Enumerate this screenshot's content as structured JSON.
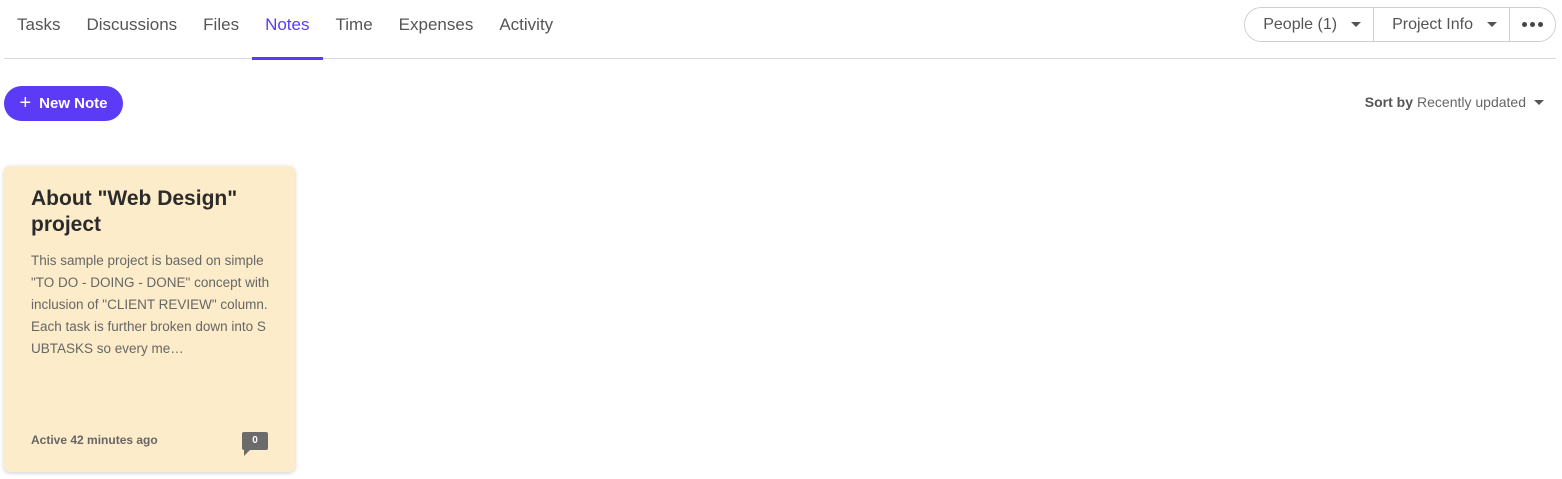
{
  "tabs": [
    {
      "label": "Tasks",
      "active": false
    },
    {
      "label": "Discussions",
      "active": false
    },
    {
      "label": "Files",
      "active": false
    },
    {
      "label": "Notes",
      "active": true
    },
    {
      "label": "Time",
      "active": false
    },
    {
      "label": "Expenses",
      "active": false
    },
    {
      "label": "Activity",
      "active": false
    }
  ],
  "header_buttons": {
    "people": "People (1)",
    "project_info": "Project Info",
    "more_icon": "ellipsis-icon"
  },
  "toolbar": {
    "new_note_label": "New Note",
    "plus_icon": "+",
    "sort_by_label": "Sort by",
    "sort_value": "Recently updated"
  },
  "notes": [
    {
      "title": "About \"Web Design\" project",
      "excerpt": "This sample project is based on simple \"TO DO - DOING - DONE\" concept with inclusion of \"CLIENT REVIEW\" column. Each task is further broken down into SUBTASKS so every me…",
      "status": "Active 42 minutes ago",
      "comment_count": "0"
    }
  ],
  "colors": {
    "accent": "#5b3bf5",
    "note_background": "#fdecca"
  }
}
